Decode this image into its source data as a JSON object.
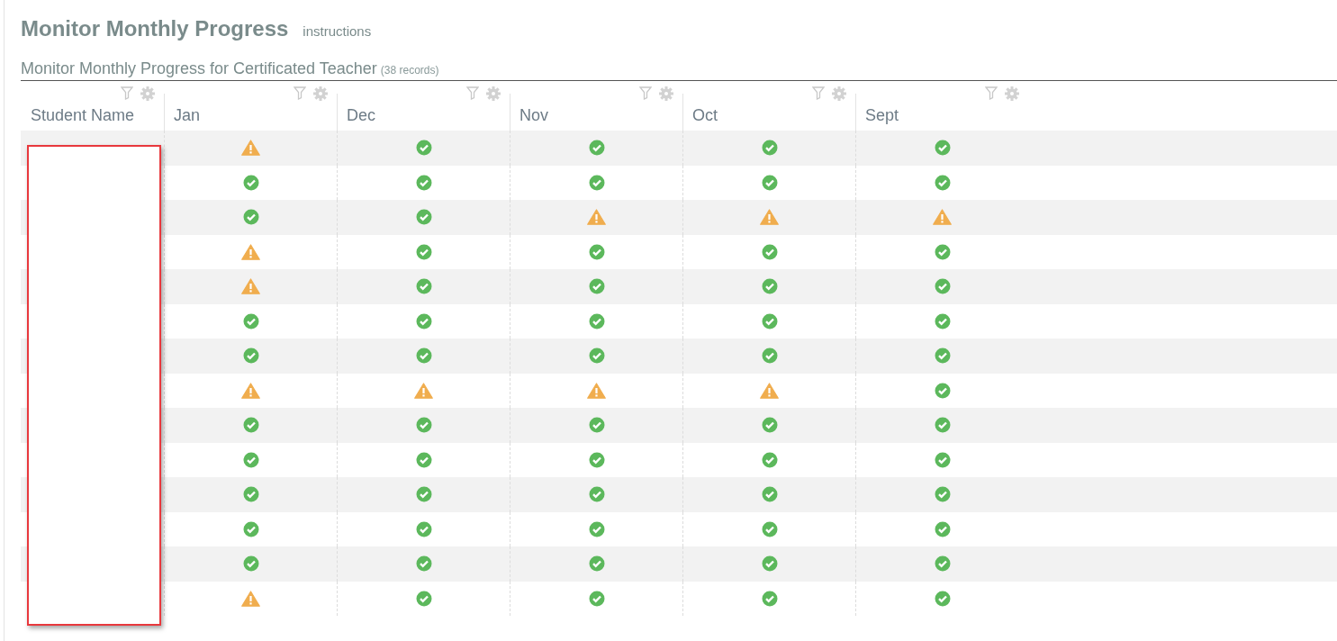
{
  "page": {
    "title": "Monitor Monthly Progress",
    "link": "instructions"
  },
  "table": {
    "title": "Monitor Monthly Progress for Certificated Teacher",
    "count": "(38 records)",
    "columns": [
      "Student Name",
      "Jan",
      "Dec",
      "Nov",
      "Oct",
      "Sept"
    ],
    "rows": [
      {
        "months": [
          {
            "ok": false
          },
          {
            "ok": true
          },
          {
            "ok": true
          },
          {
            "ok": true
          },
          {
            "ok": true
          }
        ]
      },
      {
        "months": [
          {
            "ok": true
          },
          {
            "ok": true
          },
          {
            "ok": true
          },
          {
            "ok": true
          },
          {
            "ok": true
          }
        ]
      },
      {
        "months": [
          {
            "ok": true
          },
          {
            "ok": true
          },
          {
            "ok": false
          },
          {
            "ok": false
          },
          {
            "ok": false
          }
        ]
      },
      {
        "months": [
          {
            "ok": false
          },
          {
            "ok": true
          },
          {
            "ok": true
          },
          {
            "ok": true
          },
          {
            "ok": true
          }
        ]
      },
      {
        "months": [
          {
            "ok": false
          },
          {
            "ok": true
          },
          {
            "ok": true
          },
          {
            "ok": true
          },
          {
            "ok": true
          }
        ]
      },
      {
        "months": [
          {
            "ok": true
          },
          {
            "ok": true
          },
          {
            "ok": true
          },
          {
            "ok": true
          },
          {
            "ok": true
          }
        ]
      },
      {
        "months": [
          {
            "ok": true
          },
          {
            "ok": true
          },
          {
            "ok": true
          },
          {
            "ok": true
          },
          {
            "ok": true
          }
        ]
      },
      {
        "months": [
          {
            "ok": false
          },
          {
            "ok": false
          },
          {
            "ok": false
          },
          {
            "ok": false
          },
          {
            "ok": true
          }
        ]
      },
      {
        "months": [
          {
            "ok": true
          },
          {
            "ok": true
          },
          {
            "ok": true
          },
          {
            "ok": true
          },
          {
            "ok": true
          }
        ]
      },
      {
        "months": [
          {
            "ok": true
          },
          {
            "ok": true
          },
          {
            "ok": true
          },
          {
            "ok": true
          },
          {
            "ok": true
          }
        ]
      },
      {
        "months": [
          {
            "ok": true
          },
          {
            "ok": true
          },
          {
            "ok": true
          },
          {
            "ok": true
          },
          {
            "ok": true
          }
        ]
      },
      {
        "months": [
          {
            "ok": true
          },
          {
            "ok": true
          },
          {
            "ok": true
          },
          {
            "ok": true
          },
          {
            "ok": true
          }
        ]
      },
      {
        "months": [
          {
            "ok": true
          },
          {
            "ok": true
          },
          {
            "ok": true
          },
          {
            "ok": true
          },
          {
            "ok": true
          }
        ]
      },
      {
        "months": [
          {
            "ok": false
          },
          {
            "ok": true
          },
          {
            "ok": true
          },
          {
            "ok": true
          },
          {
            "ok": true
          }
        ]
      }
    ]
  }
}
